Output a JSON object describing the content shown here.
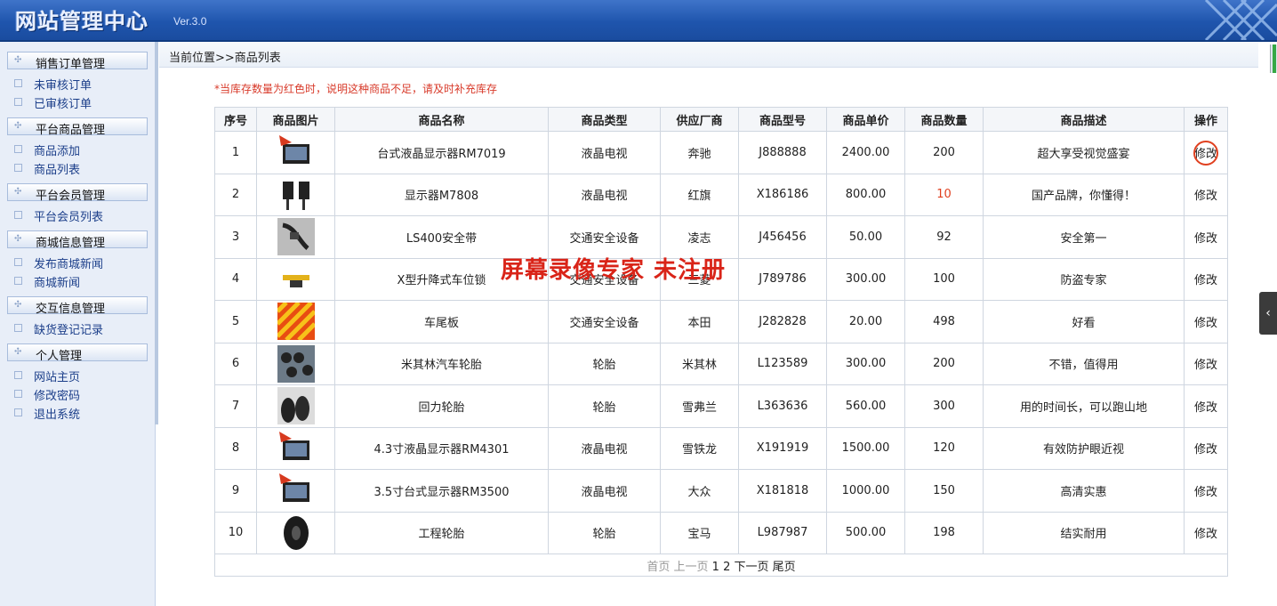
{
  "header": {
    "title": "网站管理中心",
    "version": "Ver.3.0"
  },
  "sidebar": {
    "groups": [
      {
        "label": "销售订单管理",
        "items": [
          "未审核订单",
          "已审核订单"
        ]
      },
      {
        "label": "平台商品管理",
        "items": [
          "商品添加",
          "商品列表"
        ]
      },
      {
        "label": "平台会员管理",
        "items": [
          "平台会员列表"
        ]
      },
      {
        "label": "商城信息管理",
        "items": [
          "发布商城新闻",
          "商城新闻"
        ]
      },
      {
        "label": "交互信息管理",
        "items": [
          "缺货登记记录"
        ]
      },
      {
        "label": "个人管理",
        "items": [
          "网站主页",
          "修改密码",
          "退出系统"
        ]
      }
    ]
  },
  "breadcrumb": "当前位置>>商品列表",
  "notice": "*当库存数量为红色时，说明这种商品不足，请及时补充库存",
  "table": {
    "headers": [
      "序号",
      "商品图片",
      "商品名称",
      "商品类型",
      "供应厂商",
      "商品型号",
      "商品单价",
      "商品数量",
      "商品描述",
      "操作"
    ],
    "rows": [
      {
        "no": "1",
        "image": "monitor-icon",
        "name": "台式液晶显示器RM7019",
        "type": "液晶电视",
        "vendor": "奔驰",
        "model": "J888888",
        "price": "2400.00",
        "qty": "200",
        "low": false,
        "desc": "超大享受视觉盛宴",
        "action": "修改"
      },
      {
        "no": "2",
        "image": "dual-monitor-icon",
        "name": "显示器M7808",
        "type": "液晶电视",
        "vendor": "红旗",
        "model": "X186186",
        "price": "800.00",
        "qty": "10",
        "low": true,
        "desc": "国产品牌，你懂得！",
        "action": "修改"
      },
      {
        "no": "3",
        "image": "seatbelt-icon",
        "name": "LS400安全带",
        "type": "交通安全设备",
        "vendor": "凌志",
        "model": "J456456",
        "price": "50.00",
        "qty": "92",
        "low": false,
        "desc": "安全第一",
        "action": "修改"
      },
      {
        "no": "4",
        "image": "parking-lock-icon",
        "name": "X型升降式车位锁",
        "type": "交通安全设备",
        "vendor": "三菱",
        "model": "J789786",
        "price": "300.00",
        "qty": "100",
        "low": false,
        "desc": "防盗专家",
        "action": "修改"
      },
      {
        "no": "5",
        "image": "tail-plate-icon",
        "name": "车尾板",
        "type": "交通安全设备",
        "vendor": "本田",
        "model": "J282828",
        "price": "20.00",
        "qty": "498",
        "low": false,
        "desc": "好看",
        "action": "修改"
      },
      {
        "no": "6",
        "image": "tire-store-icon",
        "name": "米其林汽车轮胎",
        "type": "轮胎",
        "vendor": "米其林",
        "model": "L123589",
        "price": "300.00",
        "qty": "200",
        "low": false,
        "desc": "不错，值得用",
        "action": "修改"
      },
      {
        "no": "7",
        "image": "tire-stack-icon",
        "name": "回力轮胎",
        "type": "轮胎",
        "vendor": "雪弗兰",
        "model": "L363636",
        "price": "560.00",
        "qty": "300",
        "low": false,
        "desc": "用的时间长，可以跑山地",
        "action": "修改"
      },
      {
        "no": "8",
        "image": "monitor-icon",
        "name": "4.3寸液晶显示器RM4301",
        "type": "液晶电视",
        "vendor": "雪铁龙",
        "model": "X191919",
        "price": "1500.00",
        "qty": "120",
        "low": false,
        "desc": "有效防护眼近视",
        "action": "修改"
      },
      {
        "no": "9",
        "image": "monitor-icon",
        "name": "3.5寸台式显示器RM3500",
        "type": "液晶电视",
        "vendor": "大众",
        "model": "X181818",
        "price": "1000.00",
        "qty": "150",
        "low": false,
        "desc": "高清实惠",
        "action": "修改"
      },
      {
        "no": "10",
        "image": "tire-icon",
        "name": "工程轮胎",
        "type": "轮胎",
        "vendor": "宝马",
        "model": "L987987",
        "price": "500.00",
        "qty": "198",
        "low": false,
        "desc": "结实耐用",
        "action": "修改"
      }
    ]
  },
  "pager": {
    "first": "首页",
    "prev": "上一页",
    "pages": [
      "1",
      "2"
    ],
    "next": "下一页",
    "last": "尾页"
  },
  "watermark": "屏幕录像专家  未注册",
  "colors": {
    "low_stock": "#e0401f",
    "header_blue": "#1f55ad"
  }
}
